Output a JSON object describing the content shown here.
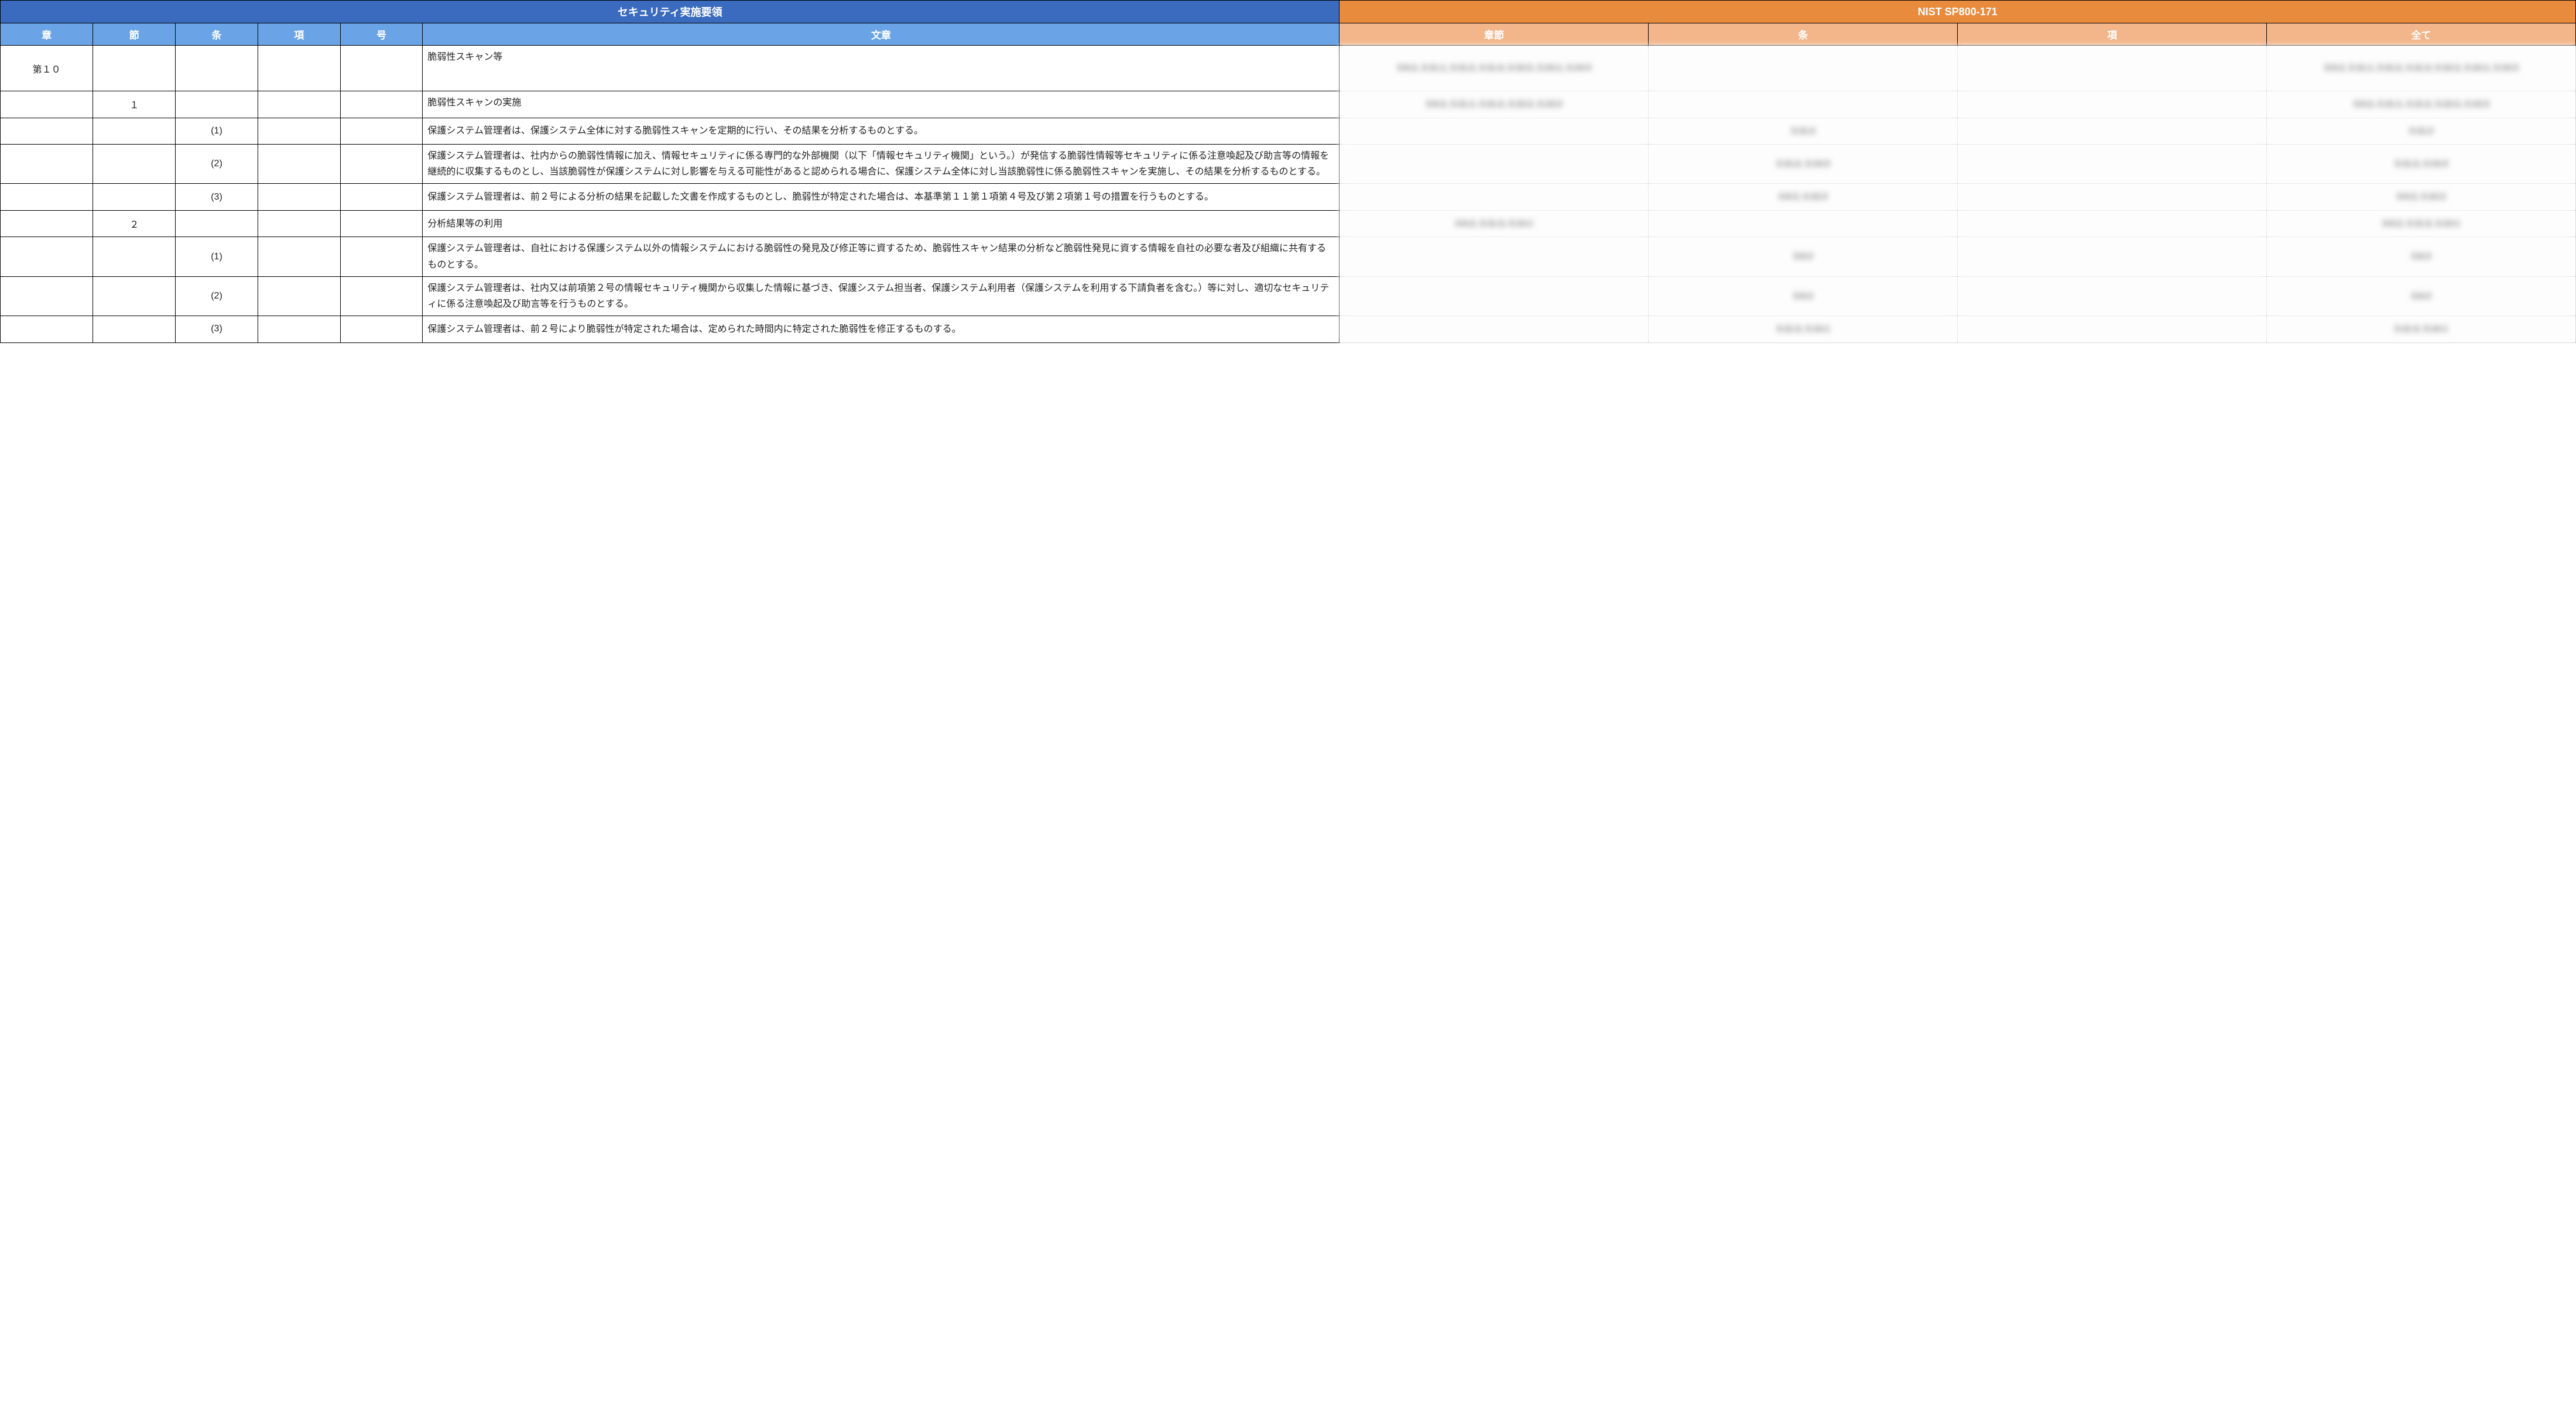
{
  "header": {
    "left_title": "セキュリティ実施要領",
    "right_title": "NIST SP800-171",
    "left_cols": [
      "章",
      "節",
      "条",
      "項",
      "号",
      "文章"
    ],
    "right_cols": [
      "章節",
      "条",
      "項",
      "全て"
    ]
  },
  "rows": [
    {
      "sho": "第１０",
      "setsu": "",
      "jo": "",
      "kou": "",
      "gou": "",
      "text": "脆弱性スキャン等",
      "map": {
        "shosetsu": "3.6.2, 3.11.1, 3.11.2, 3.11.3, 3.12.2, 3.14.1, 3.14.3",
        "jo": "",
        "kou": "",
        "all": "3.6.2, 3.11.1, 3.11.2, 3.11.3, 3.12.2, 3.14.1, 3.14.3"
      }
    },
    {
      "sho": "",
      "setsu": "１",
      "jo": "",
      "kou": "",
      "gou": "",
      "text": "脆弱性スキャンの実施",
      "map": {
        "shosetsu": "3.6.2, 3.11.1, 3.11.2, 3.12.2, 3.14.3",
        "jo": "",
        "kou": "",
        "all": "3.6.2, 3.11.1, 3.11.2, 3.12.2, 3.14.3"
      }
    },
    {
      "sho": "",
      "setsu": "",
      "jo": "(1)",
      "kou": "",
      "gou": "",
      "text": "保護システム管理者は、保護システム全体に対する脆弱性スキャンを定期的に行い、その結果を分析するものとする。",
      "map": {
        "shosetsu": "",
        "jo": "3.11.2",
        "kou": "",
        "all": "3.11.2"
      }
    },
    {
      "sho": "",
      "setsu": "",
      "jo": "(2)",
      "kou": "",
      "gou": "",
      "text": "保護システム管理者は、社内からの脆弱性情報に加え、情報セキュリティに係る専門的な外部機関（以下「情報セキュリティ機関」という。）が発信する脆弱性情報等セキュリティに係る注意喚起及び助言等の情報を継続的に収集するものとし、当該脆弱性が保護システムに対し影響を与える可能性があると認められる場合に、保護システム全体に対し当該脆弱性に係る脆弱性スキャンを実施し、その結果を分析するものとする。",
      "map": {
        "shosetsu": "",
        "jo": "3.11.2, 3.14.3",
        "kou": "",
        "all": "3.11.2, 3.14.3"
      }
    },
    {
      "sho": "",
      "setsu": "",
      "jo": "(3)",
      "kou": "",
      "gou": "",
      "text": "保護システム管理者は、前２号による分析の結果を記載した文書を作成するものとし、脆弱性が特定された場合は、本基準第１１第１項第４号及び第２項第１号の措置を行うものとする。",
      "map": {
        "shosetsu": "",
        "jo": "3.6.2, 3.12.2",
        "kou": "",
        "all": "3.6.2, 3.12.2"
      }
    },
    {
      "sho": "",
      "setsu": "２",
      "jo": "",
      "kou": "",
      "gou": "",
      "text": "分析結果等の利用",
      "map": {
        "shosetsu": "3.6.2, 3.11.3, 3.14.1",
        "jo": "",
        "kou": "",
        "all": "3.6.2, 3.11.3, 3.14.1"
      }
    },
    {
      "sho": "",
      "setsu": "",
      "jo": "(1)",
      "kou": "",
      "gou": "",
      "text": "保護システム管理者は、自社における保護システム以外の情報システムにおける脆弱性の発見及び修正等に資するため、脆弱性スキャン結果の分析など脆弱性発見に資する情報を自社の必要な者及び組織に共有するものとする。",
      "map": {
        "shosetsu": "",
        "jo": "3.6.2",
        "kou": "",
        "all": "3.6.2"
      }
    },
    {
      "sho": "",
      "setsu": "",
      "jo": "(2)",
      "kou": "",
      "gou": "",
      "text": "保護システム管理者は、社内又は前項第２号の情報セキュリティ機関から収集した情報に基づき、保護システム担当者、保護システム利用者（保護システムを利用する下請負者を含む。）等に対し、適切なセキュリティに係る注意喚起及び助言等を行うものとする。",
      "map": {
        "shosetsu": "",
        "jo": "3.6.2",
        "kou": "",
        "all": "3.6.2"
      }
    },
    {
      "sho": "",
      "setsu": "",
      "jo": "(3)",
      "kou": "",
      "gou": "",
      "text": "保護システム管理者は、前２号により脆弱性が特定された場合は、定められた時間内に特定された脆弱性を修正するものする。",
      "map": {
        "shosetsu": "",
        "jo": "3.11.3, 3.14.1",
        "kou": "",
        "all": "3.11.3, 3.14.1"
      }
    }
  ]
}
